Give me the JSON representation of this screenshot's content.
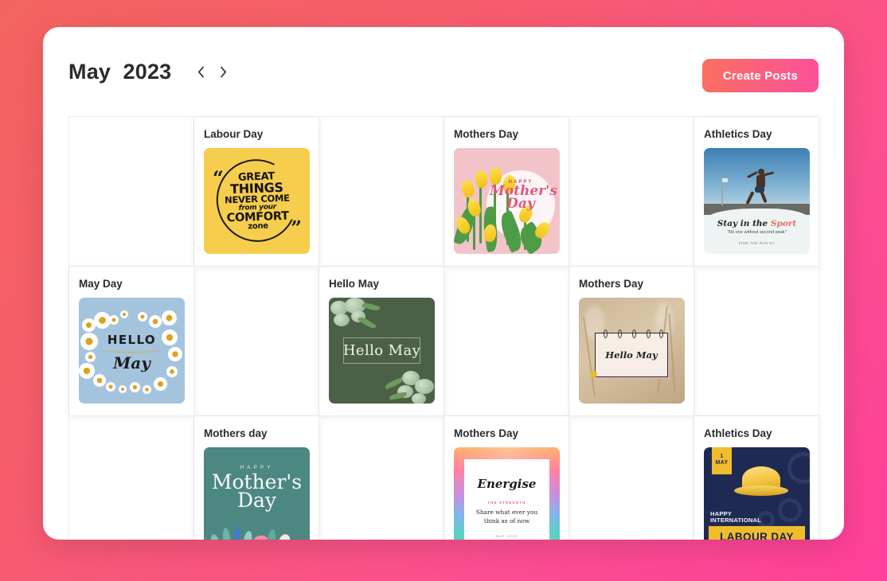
{
  "theme": {
    "frame_gradient_start": "#f4645f",
    "frame_gradient_end": "#ff3f9a",
    "accent": "#fb5f7e",
    "panel_background": "#ffffff",
    "grid_line": "#ececec"
  },
  "header": {
    "title": "May  2023",
    "month": "May",
    "year": "2023",
    "prev_label": "‹",
    "next_label": "›",
    "create_button_label": "Create Posts"
  },
  "calendar": {
    "columns": 6,
    "rows": 3,
    "cells": [
      {
        "index": 0,
        "row": 1,
        "col": 1,
        "has_post": false,
        "label": "",
        "art": ""
      },
      {
        "index": 1,
        "row": 1,
        "col": 2,
        "has_post": true,
        "label": "Labour Day",
        "art": "quote-yellow"
      },
      {
        "index": 2,
        "row": 1,
        "col": 3,
        "has_post": false,
        "label": "",
        "art": ""
      },
      {
        "index": 3,
        "row": 1,
        "col": 4,
        "has_post": true,
        "label": "Mothers Day",
        "art": "tulips"
      },
      {
        "index": 4,
        "row": 1,
        "col": 5,
        "has_post": false,
        "label": "",
        "art": ""
      },
      {
        "index": 5,
        "row": 1,
        "col": 6,
        "has_post": true,
        "label": "Athletics Day",
        "art": "runner"
      },
      {
        "index": 6,
        "row": 2,
        "col": 1,
        "has_post": true,
        "label": "May Day",
        "art": "daisy"
      },
      {
        "index": 7,
        "row": 2,
        "col": 2,
        "has_post": false,
        "label": "",
        "art": ""
      },
      {
        "index": 8,
        "row": 2,
        "col": 3,
        "has_post": true,
        "label": "Hello May",
        "art": "green"
      },
      {
        "index": 9,
        "row": 2,
        "col": 4,
        "has_post": false,
        "label": "",
        "art": ""
      },
      {
        "index": 10,
        "row": 2,
        "col": 5,
        "has_post": true,
        "label": "Mothers Day",
        "art": "wheat"
      },
      {
        "index": 11,
        "row": 2,
        "col": 6,
        "has_post": false,
        "label": "",
        "art": ""
      },
      {
        "index": 12,
        "row": 3,
        "col": 1,
        "has_post": false,
        "label": "",
        "art": ""
      },
      {
        "index": 13,
        "row": 3,
        "col": 2,
        "has_post": true,
        "label": "Mothers day",
        "art": "teal"
      },
      {
        "index": 14,
        "row": 3,
        "col": 3,
        "has_post": false,
        "label": "",
        "art": ""
      },
      {
        "index": 15,
        "row": 3,
        "col": 4,
        "has_post": true,
        "label": "Mothers Day",
        "art": "rainbow"
      },
      {
        "index": 16,
        "row": 3,
        "col": 5,
        "has_post": false,
        "label": "",
        "art": ""
      },
      {
        "index": 17,
        "row": 3,
        "col": 6,
        "has_post": true,
        "label": "Athletics Day",
        "art": "navy"
      }
    ]
  },
  "artwork": {
    "quote_yellow": {
      "line1": "GREAT",
      "line2": "THINGS",
      "line3": "NEVER COME",
      "line4": "from your",
      "line5": "COMFORT",
      "line6": "zone",
      "quote_open": "“",
      "quote_close": "”",
      "background": "#f6cd4c"
    },
    "tulips": {
      "happy": "HAPPY",
      "script_line1": "Mother's",
      "script_line2": "Day",
      "background": "#f2c4ca"
    },
    "runner": {
      "caption_bold": "Stay in the ",
      "caption_accent": "Sport",
      "subcaption": "“No one without second peak”",
      "footer": "FIND THE RUN BY",
      "background": "#eef3f3"
    },
    "daisy": {
      "hello": "HELLO",
      "may": "May",
      "background": "#a4c4de"
    },
    "green": {
      "text": "Hello May",
      "background": "#4b6146"
    },
    "wheat": {
      "notepad_text": "Hello May",
      "background": "#cbb698"
    },
    "teal": {
      "happy": "HAPPY",
      "line1": "Mother's",
      "line2": "Day",
      "background": "#4d8782"
    },
    "rainbow": {
      "title": "Energise",
      "eyebrow": "THE STRENGTH",
      "body_line1": "Share what ever you",
      "body_line2": "think as of now",
      "footer": "MAY  2023",
      "background": "#ffffff"
    },
    "navy": {
      "date_day": "1",
      "date_month": "MAY",
      "happy_line1": "HAPPY",
      "happy_line2": "INTERNATIONAL",
      "banner": "LABOUR DAY",
      "background": "#1f2a52"
    }
  }
}
